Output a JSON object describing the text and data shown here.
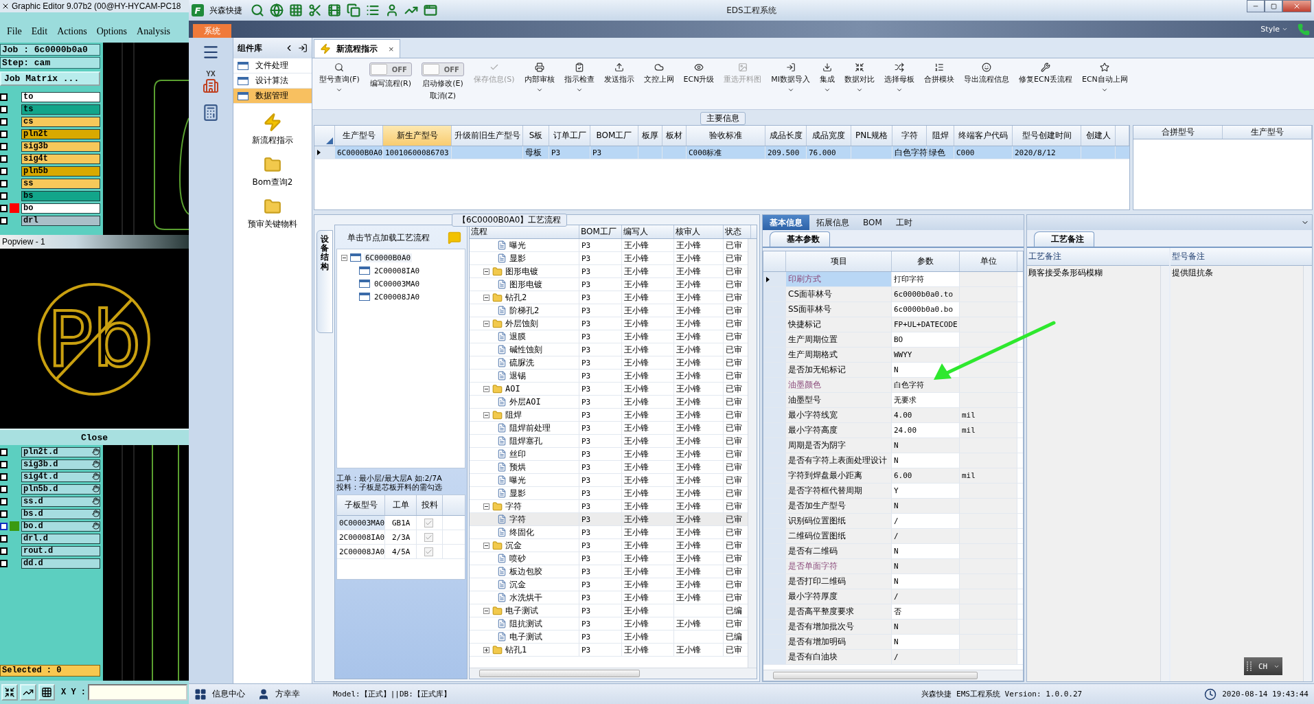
{
  "graphic_editor": {
    "title": "Graphic Editor 9.07b2 (00@HY-HYCAM-PC18",
    "menu": [
      "File",
      "Edit",
      "Actions",
      "Options",
      "Analysis"
    ],
    "job": "Job : 6c0000b0a0",
    "step": "Step: cam",
    "matrix_button": "Job Matrix ...",
    "layers": [
      {
        "name": "to",
        "color": "#ffffff",
        "active": false,
        "checked": false
      },
      {
        "name": "ts",
        "color": "#12a58a",
        "active": false,
        "checked": false
      },
      {
        "name": "cs",
        "color": "#f7c85a",
        "active": false,
        "checked": false
      },
      {
        "name": "pln2t",
        "color": "#d9a900",
        "active": false,
        "checked": false
      },
      {
        "name": "sig3b",
        "color": "#f7c85a",
        "active": false,
        "checked": false
      },
      {
        "name": "sig4t",
        "color": "#f7c85a",
        "active": false,
        "checked": false
      },
      {
        "name": "pln5b",
        "color": "#d9a900",
        "active": false,
        "checked": false
      },
      {
        "name": "ss",
        "color": "#f7c85a",
        "active": false,
        "checked": false
      },
      {
        "name": "bs",
        "color": "#12a58a",
        "active": false,
        "checked": false
      },
      {
        "name": "bo",
        "color": "#ffffff",
        "active": true,
        "checked": false
      },
      {
        "name": "drl",
        "color": "#a9bfc8",
        "active": false,
        "checked": false
      }
    ],
    "popview": {
      "title": "Popview - 1",
      "mark": "Pb",
      "close": "Close"
    },
    "drill_layers": [
      {
        "name": "pln2t.d",
        "active": false,
        "affected": true,
        "checked": false
      },
      {
        "name": "sig3b.d",
        "active": false,
        "affected": true,
        "checked": false
      },
      {
        "name": "sig4t.d",
        "active": false,
        "affected": true,
        "checked": false
      },
      {
        "name": "pln5b.d",
        "active": false,
        "affected": true,
        "checked": false
      },
      {
        "name": "ss.d",
        "active": false,
        "affected": true,
        "checked": false
      },
      {
        "name": "bs.d",
        "active": false,
        "affected": true,
        "checked": false
      },
      {
        "name": "bo.d",
        "active": true,
        "affected": true,
        "checked": false
      },
      {
        "name": "drl.d",
        "active": false,
        "affected": false,
        "checked": false
      },
      {
        "name": "rout.d",
        "active": false,
        "affected": false,
        "checked": false
      },
      {
        "name": "dd.d",
        "active": false,
        "affected": false,
        "checked": false
      }
    ],
    "selected_count": "Selected : 0",
    "xy_label": "X Y :"
  },
  "eds": {
    "logo_letter": "F",
    "app_name": "兴森快捷",
    "title": "EDS工程系统",
    "ribbon_tab": "系统",
    "style_label": "Style",
    "nav_logo": "YX",
    "library": {
      "title": "组件库",
      "items": [
        {
          "label": "文件处理",
          "selected": false
        },
        {
          "label": "设计算法",
          "selected": false
        },
        {
          "label": "数据管理",
          "selected": true
        }
      ],
      "tools": [
        {
          "label": "新流程指示",
          "kind": "lightning"
        },
        {
          "label": "Bom查询2",
          "kind": "folder"
        },
        {
          "label": "预审关键物料",
          "kind": "folder"
        }
      ]
    },
    "doc_tab": {
      "label": "新流程指示",
      "close": "×"
    },
    "toolbar": [
      {
        "kind": "button",
        "label": "型号查询(F)",
        "dropdown": true,
        "disabled": false
      },
      {
        "kind": "toggle",
        "state": "OFF",
        "on": false,
        "label": "编写流程(R)"
      },
      {
        "kind": "toggle",
        "state": "OFF",
        "on": false,
        "label": "启动修改(E)",
        "sublabel": "取消(Z)"
      },
      {
        "kind": "button",
        "label": "保存信息(S)",
        "dropdown": false,
        "disabled": true
      },
      {
        "kind": "button",
        "label": "内部审核",
        "dropdown": true,
        "disabled": false
      },
      {
        "kind": "button",
        "label": "指示检查",
        "dropdown": true,
        "disabled": false
      },
      {
        "kind": "button",
        "label": "发送指示",
        "dropdown": false,
        "disabled": false
      },
      {
        "kind": "button",
        "label": "文控上网",
        "dropdown": false,
        "disabled": false
      },
      {
        "kind": "button",
        "label": "ECN升级",
        "dropdown": false,
        "disabled": false
      },
      {
        "kind": "button",
        "label": "重选开料图",
        "dropdown": false,
        "disabled": true
      },
      {
        "kind": "button",
        "label": "MI数据导入",
        "dropdown": true,
        "disabled": false
      },
      {
        "kind": "button",
        "label": "集成",
        "dropdown": true,
        "disabled": false
      },
      {
        "kind": "button",
        "label": "数据对比",
        "dropdown": true,
        "disabled": false
      },
      {
        "kind": "button",
        "label": "选择母板",
        "dropdown": true,
        "disabled": false
      },
      {
        "kind": "button",
        "label": "合拼模块",
        "dropdown": false,
        "disabled": false
      },
      {
        "kind": "button",
        "label": "导出流程信息",
        "dropdown": false,
        "disabled": false
      },
      {
        "kind": "button",
        "label": "修复ECN丢流程",
        "dropdown": false,
        "disabled": false
      },
      {
        "kind": "button",
        "label": "ECN自动上网",
        "dropdown": true,
        "disabled": false
      }
    ],
    "main_info": {
      "title": "主要信息",
      "columns": [
        {
          "label": "生产型号",
          "selected": false
        },
        {
          "label": "新生产型号",
          "selected": true
        },
        {
          "label": "升级前旧生产型号",
          "selected": false
        },
        {
          "label": "S板",
          "selected": false
        },
        {
          "label": "订单工厂",
          "selected": false
        },
        {
          "label": "BOM工厂",
          "selected": false
        },
        {
          "label": "板厚",
          "selected": false
        },
        {
          "label": "板材",
          "selected": false
        },
        {
          "label": "验收标准",
          "selected": false
        },
        {
          "label": "成品长度",
          "selected": false
        },
        {
          "label": "成品宽度",
          "selected": false
        },
        {
          "label": "PNL规格",
          "selected": false
        },
        {
          "label": "字符",
          "selected": false
        },
        {
          "label": "阻焊",
          "selected": false
        },
        {
          "label": "终端客户代码",
          "selected": false
        },
        {
          "label": "型号创建时间",
          "selected": false
        },
        {
          "label": "创建人",
          "selected": false
        }
      ],
      "rows": [
        {
          "selected": true,
          "cells": [
            "6C0000B0A0",
            "10010600086703",
            null,
            "母板",
            "P3",
            "P3",
            null,
            null,
            "C000标准",
            "209.500",
            "76.000",
            null,
            "白色字符",
            "绿色",
            "C000",
            "2020/8/12",
            null
          ]
        }
      ],
      "merge_columns": [
        "合拼型号",
        "生产型号"
      ]
    },
    "process": {
      "title": "【6C0000B0A0】工艺流程",
      "side_tab": "设备结构",
      "tree_header": "单击节点加载工艺流程",
      "tree": {
        "label": "6C0000B0A0",
        "expanded": true,
        "children": [
          {
            "label": "2C00008IA0"
          },
          {
            "label": "0C00003MA0"
          },
          {
            "label": "2C00008JA0"
          }
        ]
      },
      "notes": [
        "工单：最小层/最大层A 如:2/7A",
        "投料：子板是芯板开料的需勾选"
      ],
      "sub_table": {
        "columns": [
          "子板型号",
          "工单",
          "投料"
        ],
        "rows": [
          {
            "cells": [
              "0C00003MA0",
              "GB1A"
            ],
            "checked": true,
            "selected": true
          },
          {
            "cells": [
              "2C00008IA0",
              "2/3A"
            ],
            "checked": true,
            "selected": false
          },
          {
            "cells": [
              "2C00008JA0",
              "4/5A"
            ],
            "checked": true,
            "selected": false
          }
        ]
      },
      "grid": {
        "columns": [
          "流程",
          "BOM工厂",
          "编写人",
          "核审人",
          "状态"
        ],
        "rows": [
          {
            "children": [
              {
                "name": "曝光",
                "bom": "P3",
                "writer": "王小锋",
                "reviewer": "王小锋",
                "status": "已审",
                "selected": false
              },
              {
                "name": "显影",
                "bom": "P3",
                "writer": "王小锋",
                "reviewer": "王小锋",
                "status": "已审",
                "selected": false
              }
            ]
          },
          {
            "name": "图形电镀",
            "bom": "P3",
            "writer": "王小锋",
            "reviewer": "王小锋",
            "status": "已审",
            "expanded": true,
            "children": [
              {
                "name": "图形电镀",
                "bom": "P3",
                "writer": "王小锋",
                "reviewer": "王小锋",
                "status": "已审",
                "selected": false
              }
            ]
          },
          {
            "name": "钻孔2",
            "bom": "P3",
            "writer": "王小锋",
            "reviewer": "王小锋",
            "status": "已审",
            "expanded": true,
            "children": [
              {
                "name": "阶梯孔2",
                "bom": "P3",
                "writer": "王小锋",
                "reviewer": "王小锋",
                "status": "已审",
                "selected": false
              }
            ]
          },
          {
            "name": "外层蚀刻",
            "bom": "P3",
            "writer": "王小锋",
            "reviewer": "王小锋",
            "status": "已审",
            "expanded": true,
            "children": [
              {
                "name": "退膜",
                "bom": "P3",
                "writer": "王小锋",
                "reviewer": "王小锋",
                "status": "已审",
                "selected": false
              },
              {
                "name": "碱性蚀刻",
                "bom": "P3",
                "writer": "王小锋",
                "reviewer": "王小锋",
                "status": "已审",
                "selected": false
              },
              {
                "name": "硫脲洗",
                "bom": "P3",
                "writer": "王小锋",
                "reviewer": "王小锋",
                "status": "已审",
                "selected": false
              },
              {
                "name": "退锡",
                "bom": "P3",
                "writer": "王小锋",
                "reviewer": "王小锋",
                "status": "已审",
                "selected": false
              }
            ]
          },
          {
            "name": "AOI",
            "bom": "P3",
            "writer": "王小锋",
            "reviewer": "王小锋",
            "status": "已审",
            "expanded": true,
            "children": [
              {
                "name": "外层AOI",
                "bom": "P3",
                "writer": "王小锋",
                "reviewer": "王小锋",
                "status": "已审",
                "selected": false
              }
            ]
          },
          {
            "name": "阻焊",
            "bom": "P3",
            "writer": "王小锋",
            "reviewer": "王小锋",
            "status": "已审",
            "expanded": true,
            "children": [
              {
                "name": "阻焊前处理",
                "bom": "P3",
                "writer": "王小锋",
                "reviewer": "王小锋",
                "status": "已审",
                "selected": false
              },
              {
                "name": "阻焊塞孔",
                "bom": "P3",
                "writer": "王小锋",
                "reviewer": "王小锋",
                "status": "已审",
                "selected": false
              },
              {
                "name": "丝印",
                "bom": "P3",
                "writer": "王小锋",
                "reviewer": "王小锋",
                "status": "已审",
                "selected": false
              },
              {
                "name": "预烘",
                "bom": "P3",
                "writer": "王小锋",
                "reviewer": "王小锋",
                "status": "已审",
                "selected": false
              },
              {
                "name": "曝光",
                "bom": "P3",
                "writer": "王小锋",
                "reviewer": "王小锋",
                "status": "已审",
                "selected": false
              },
              {
                "name": "显影",
                "bom": "P3",
                "writer": "王小锋",
                "reviewer": "王小锋",
                "status": "已审",
                "selected": false
              }
            ]
          },
          {
            "name": "字符",
            "bom": "P3",
            "writer": "王小锋",
            "reviewer": "王小锋",
            "status": "已审",
            "expanded": true,
            "children": [
              {
                "name": "字符",
                "bom": "P3",
                "writer": "王小锋",
                "reviewer": "王小锋",
                "status": "已审",
                "selected": true
              },
              {
                "name": "终固化",
                "bom": "P3",
                "writer": "王小锋",
                "reviewer": "王小锋",
                "status": "已审",
                "selected": false
              }
            ]
          },
          {
            "name": "沉金",
            "bom": "P3",
            "writer": "王小锋",
            "reviewer": "王小锋",
            "status": "已审",
            "expanded": true,
            "children": [
              {
                "name": "喷砂",
                "bom": "P3",
                "writer": "王小锋",
                "reviewer": "王小锋",
                "status": "已审",
                "selected": false
              },
              {
                "name": "板边包胶",
                "bom": "P3",
                "writer": "王小锋",
                "reviewer": "王小锋",
                "status": "已审",
                "selected": false
              },
              {
                "name": "沉金",
                "bom": "P3",
                "writer": "王小锋",
                "reviewer": "王小锋",
                "status": "已审",
                "selected": false
              },
              {
                "name": "水洗烘干",
                "bom": "P3",
                "writer": "王小锋",
                "reviewer": "王小锋",
                "status": "已审",
                "selected": false
              }
            ]
          },
          {
            "name": "电子测试",
            "bom": "P3",
            "writer": "王小锋",
            "status": "已编",
            "expanded": true,
            "children": [
              {
                "name": "阻抗测试",
                "bom": "P3",
                "writer": "王小锋",
                "reviewer": "王小锋",
                "status": "已审",
                "selected": false
              },
              {
                "name": "电子测试",
                "bom": "P3",
                "writer": "王小锋",
                "status": "已编",
                "selected": false
              }
            ]
          },
          {
            "name": "钻孔1",
            "bom": "P3",
            "writer": "王小锋",
            "reviewer": "王小锋",
            "status": "已审",
            "expanded": false
          }
        ]
      }
    },
    "params": {
      "tabs": [
        {
          "label": "基本信息",
          "selected": true
        },
        {
          "label": "拓展信息",
          "selected": false
        },
        {
          "label": "BOM",
          "selected": false
        },
        {
          "label": "工时",
          "selected": false
        }
      ],
      "sub_tab": "基本参数",
      "columns": [
        "项目",
        "参数",
        "单位"
      ],
      "rows": [
        {
          "item": "印刷方式",
          "value": "打印字符",
          "flagged": true,
          "selected": true
        },
        {
          "item": "CS面菲林号",
          "value": "6c0000b0a0.to",
          "flagged": false,
          "selected": false
        },
        {
          "item": "SS面菲林号",
          "value": "6c0000b0a0.bo",
          "flagged": false,
          "selected": false
        },
        {
          "item": "快捷标记",
          "value": "FP+UL+DATECODE",
          "flagged": false,
          "selected": false
        },
        {
          "item": "生产周期位置",
          "value": "BO",
          "flagged": false,
          "selected": false
        },
        {
          "item": "生产周期格式",
          "value": "WWYY",
          "flagged": false,
          "selected": false
        },
        {
          "item": "是否加无铅标记",
          "value": "N",
          "flagged": false,
          "selected": false
        },
        {
          "item": "油墨颜色",
          "value": "白色字符",
          "flagged": true,
          "selected": false
        },
        {
          "item": "油墨型号",
          "value": "无要求",
          "flagged": false,
          "selected": false
        },
        {
          "item": "最小字符线宽",
          "value": "4.00",
          "unit": "mil",
          "flagged": false,
          "selected": false
        },
        {
          "item": "最小字符高度",
          "value": "24.00",
          "unit": "mil",
          "flagged": false,
          "selected": false
        },
        {
          "item": "周期是否为阴字",
          "value": "N",
          "flagged": false,
          "selected": false
        },
        {
          "item": "是否有字符上表面处理设计",
          "value": "N",
          "flagged": false,
          "selected": false
        },
        {
          "item": "字符到焊盘最小距离",
          "value": "6.00",
          "unit": "mil",
          "flagged": false,
          "selected": false
        },
        {
          "item": "是否字符框代替周期",
          "value": "Y",
          "flagged": false,
          "selected": false
        },
        {
          "item": "是否加生产型号",
          "value": "N",
          "flagged": false,
          "selected": false
        },
        {
          "item": "识别码位置图纸",
          "value": "/",
          "flagged": false,
          "selected": false
        },
        {
          "item": "二维码位置图纸",
          "value": "/",
          "flagged": false,
          "selected": false
        },
        {
          "item": "是否有二维码",
          "value": "N",
          "flagged": false,
          "selected": false
        },
        {
          "item": "是否单面字符",
          "value": "N",
          "flagged": true,
          "selected": false
        },
        {
          "item": "是否打印二维码",
          "value": "N",
          "flagged": false,
          "selected": false
        },
        {
          "item": "最小字符厚度",
          "value": "/",
          "flagged": false,
          "selected": false
        },
        {
          "item": "是否高平整度要求",
          "value": "否",
          "flagged": false,
          "selected": false
        },
        {
          "item": "是否有增加批次号",
          "value": "N",
          "flagged": false,
          "selected": false
        },
        {
          "item": "是否有增加明码",
          "value": "N",
          "flagged": false,
          "selected": false
        },
        {
          "item": "是否有白油块",
          "value": "/",
          "flagged": false,
          "selected": false
        }
      ]
    },
    "remarks": {
      "tab": "工艺备注",
      "columns": [
        {
          "label": "工艺备注",
          "text": "顾客接受条形码模糊"
        },
        {
          "label": "型号备注",
          "text": "提供阻抗条"
        }
      ]
    },
    "status": {
      "info": "信息中心",
      "user": "方幸幸",
      "model": "Model:【正式】||DB:【正式库】",
      "version": "兴森快捷 EMS工程系统 Version: 1.0.0.27",
      "time": "2020-08-14 19:43:44"
    },
    "ime": "CH"
  }
}
